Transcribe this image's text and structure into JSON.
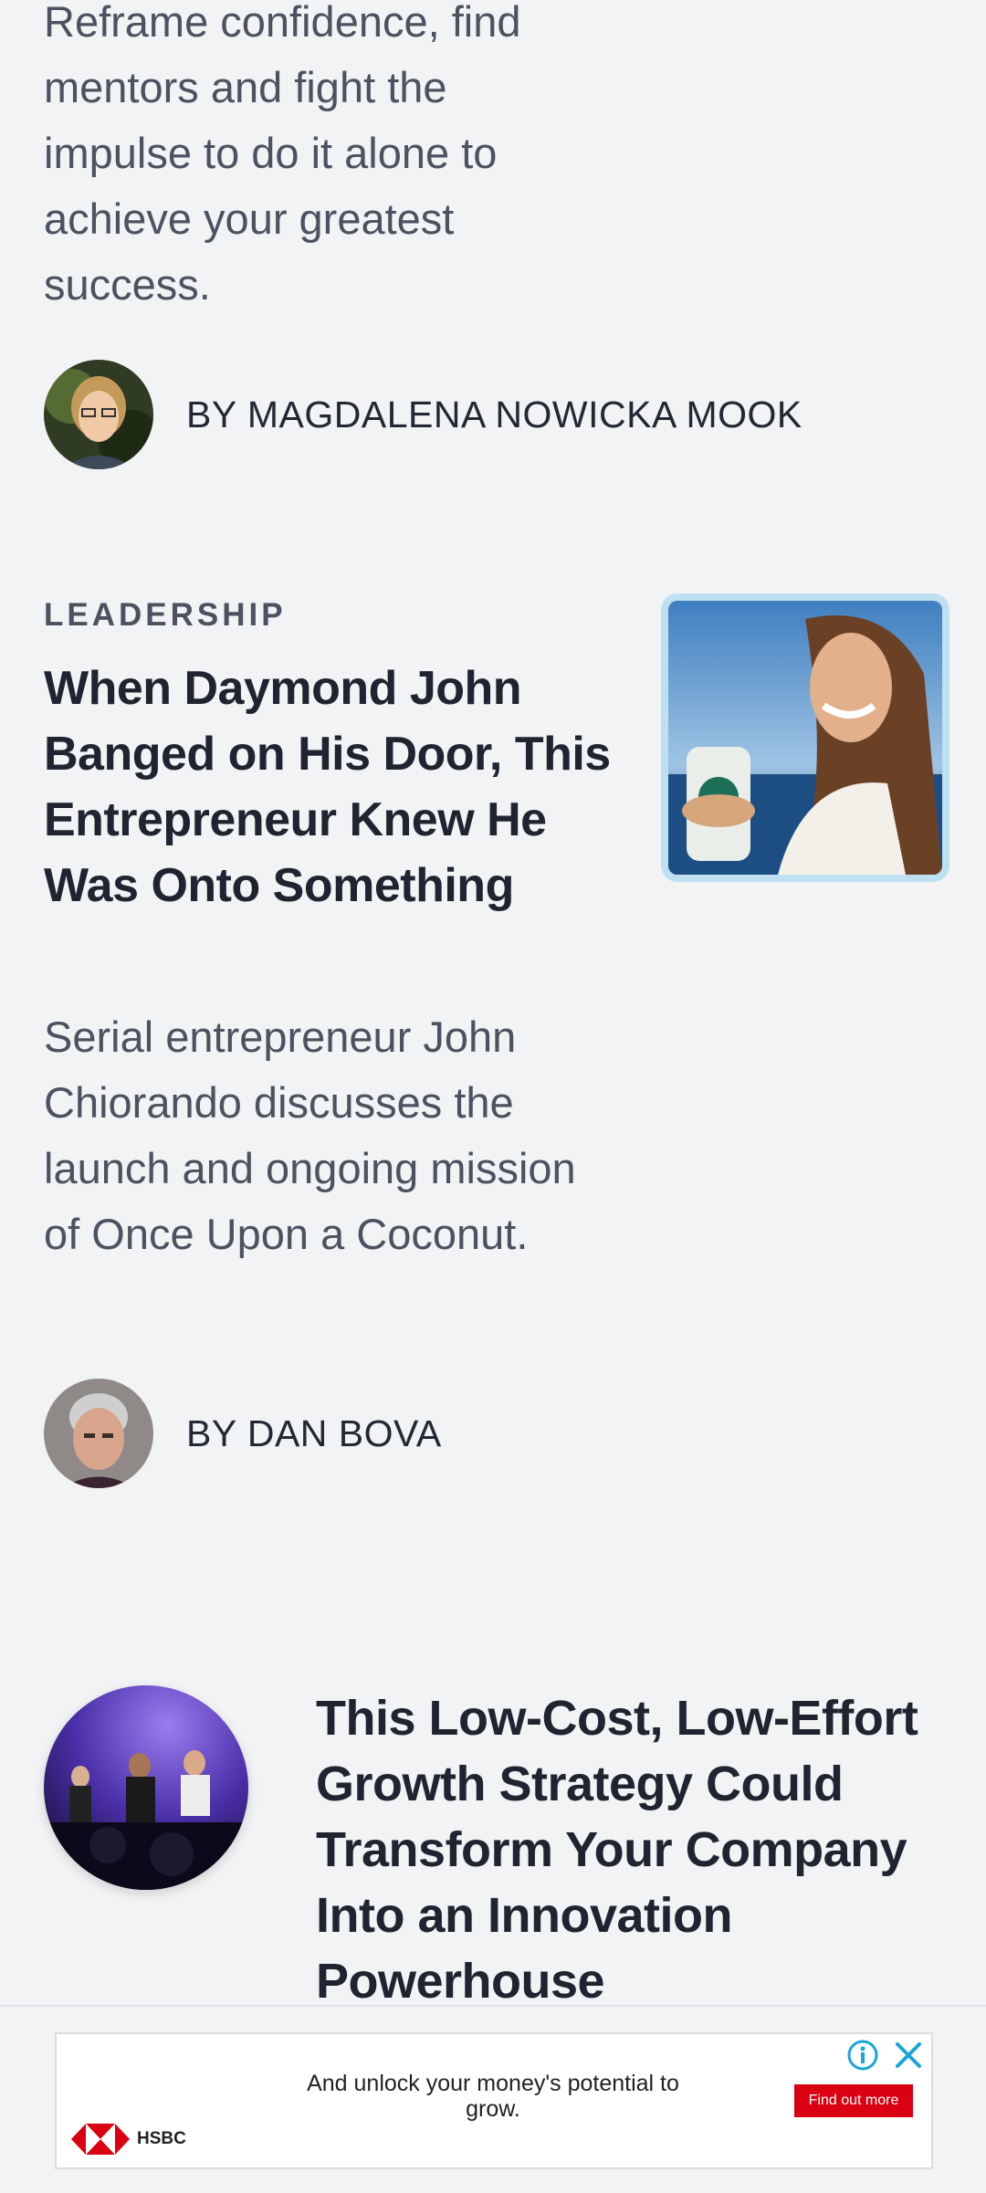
{
  "snippet": {
    "text": "Reframe confidence, find mentors and fight the impulse to do it alone to achieve your greatest success.",
    "author": "BY MAGDALENA NOWICKA MOOK"
  },
  "article": {
    "category": "LEADERSHIP",
    "headline": "When Daymond John Banged on His Door, This Entrepreneur Knew He Was Onto Something",
    "dek": "Serial entrepreneur John Chiorando discusses the launch and ongoing mission of Once Upon a Coconut.",
    "author": "BY DAN BOVA"
  },
  "feature": {
    "title": "This Low-Cost, Low-Effort Growth Strategy Could Transform Your Company Into an Innovation Powerhouse"
  },
  "ad": {
    "text": "And unlock your money's potential to grow.",
    "cta": "Find out more",
    "brand": "HSBC",
    "colors": {
      "brand_red": "#db0011",
      "accent_info": "#1aa5d8"
    }
  }
}
